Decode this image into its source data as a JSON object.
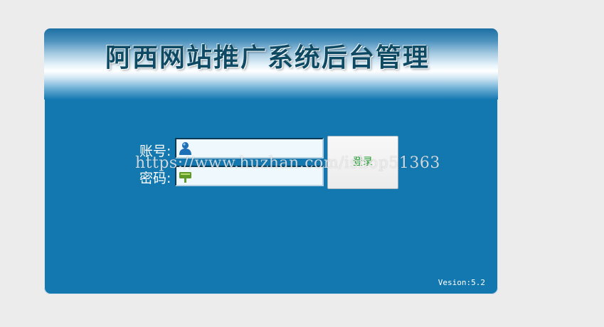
{
  "header": {
    "title": "阿西网站推广系统后台管理"
  },
  "form": {
    "account_label": "账号:",
    "password_label": "密码:",
    "account_value": "",
    "password_value": "",
    "account_icon": "user-icon",
    "password_icon": "key-icon",
    "login_button_label": "登录"
  },
  "footer": {
    "version": "Vesion:5.2"
  },
  "watermark": {
    "text": "https://www.huzhan.com/ishop51363"
  },
  "colors": {
    "page_background": "#ececec",
    "panel_background": "#1478b0",
    "title_color": "#0e4a63",
    "login_text": "#1f9a2e"
  }
}
